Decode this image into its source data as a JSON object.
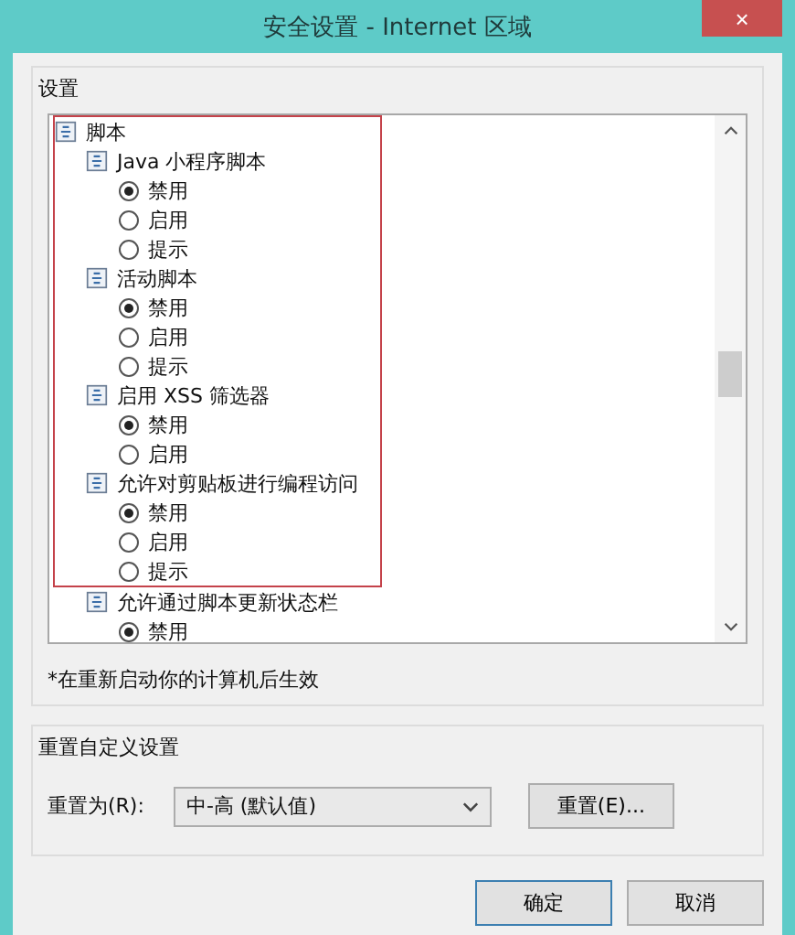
{
  "window": {
    "title": "安全设置 - Internet 区域",
    "close": "×"
  },
  "settings_group": {
    "title": "设置",
    "tree": {
      "label": "脚本",
      "highlighted": true,
      "children": [
        {
          "label": "Java 小程序脚本",
          "highlighted": true,
          "options": [
            {
              "label": "禁用",
              "selected": true
            },
            {
              "label": "启用",
              "selected": false
            },
            {
              "label": "提示",
              "selected": false
            }
          ]
        },
        {
          "label": "活动脚本",
          "highlighted": true,
          "options": [
            {
              "label": "禁用",
              "selected": true
            },
            {
              "label": "启用",
              "selected": false
            },
            {
              "label": "提示",
              "selected": false
            }
          ]
        },
        {
          "label": "启用 XSS 筛选器",
          "highlighted": true,
          "options": [
            {
              "label": "禁用",
              "selected": true
            },
            {
              "label": "启用",
              "selected": false
            }
          ]
        },
        {
          "label": "允许对剪贴板进行编程访问",
          "highlighted": true,
          "options": [
            {
              "label": "禁用",
              "selected": true
            },
            {
              "label": "启用",
              "selected": false
            },
            {
              "label": "提示",
              "selected": false
            }
          ]
        },
        {
          "label": "允许通过脚本更新状态栏",
          "highlighted": false,
          "options": [
            {
              "label": "禁用",
              "selected": true
            }
          ]
        }
      ]
    },
    "note": "*在重新启动你的计算机后生效"
  },
  "reset_group": {
    "title": "重置自定义设置",
    "label": "重置为(R):",
    "value": "中-高 (默认值)",
    "button": "重置(E)..."
  },
  "buttons": [
    "确定",
    "取消"
  ]
}
